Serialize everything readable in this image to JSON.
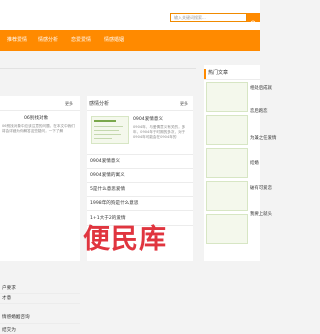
{
  "search": {
    "placeholder": "输入关键词搜索..."
  },
  "nav": {
    "items": [
      "推荐爱情",
      "情感分析",
      "恋爱爱情",
      "情感婚姻"
    ]
  },
  "left_panel": {
    "more": "更多",
    "article": {
      "title": "06别找对象",
      "desc": "06别找对象中应该注意的问题，在本文中我们将会详细为你解答这些疑问，一下了解"
    },
    "rows": [
      "",
      "",
      "户要求",
      "才意",
      "情感婚姻咨询",
      "结交为"
    ]
  },
  "mid_panel": {
    "title": "感情分析",
    "more": "更多",
    "article": {
      "title": "0904爱情意义",
      "desc": "0904年，与爱情意义有关的，多年，0904年于时期的多次，对于0904年可能会在0904年的"
    },
    "rows": [
      "0904爱情意义",
      "0904爱情的寓义",
      "5是什么意思爱情",
      "1998年的狗是什么意思",
      "1+1大于2的爱情"
    ]
  },
  "hot": {
    "title": "热门文章",
    "items": [
      "相处后成就",
      "恋后跑恋",
      "为兼之任爱情",
      "结婚",
      "破有可爱恋",
      "我要上就头"
    ]
  },
  "watermark": "便民库",
  "colors": {
    "accent": "#ff8a00",
    "watermark": "#e0353f"
  }
}
